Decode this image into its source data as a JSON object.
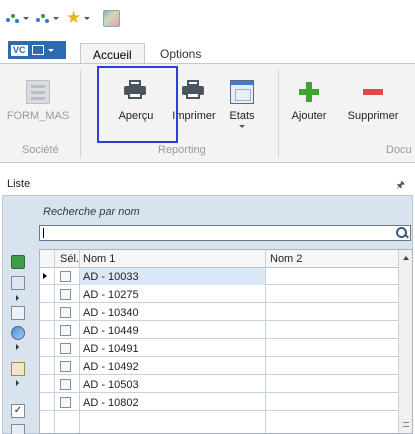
{
  "quick_access": {
    "icons": [
      "app-dots-icon",
      "app-dots-icon",
      "favorites-star-icon",
      "image-icon"
    ]
  },
  "tabs": {
    "file_badge": "VC",
    "items": [
      {
        "label": "Accueil",
        "active": true
      },
      {
        "label": "Options",
        "active": false
      }
    ]
  },
  "ribbon": {
    "buttons": [
      {
        "label": "FORM_MAS",
        "icon": "form-icon",
        "disabled": true
      },
      {
        "label": "Aperçu",
        "icon": "print-preview-icon",
        "disabled": false
      },
      {
        "label": "Imprimer",
        "icon": "printer-icon",
        "disabled": false
      },
      {
        "label": "Etats",
        "icon": "reports-icon",
        "disabled": false
      },
      {
        "label": "Ajouter",
        "icon": "add-icon",
        "disabled": false
      },
      {
        "label": "Supprimer",
        "icon": "delete-icon",
        "disabled": false
      }
    ],
    "groups": [
      "Société",
      "Reporting",
      "Docu"
    ]
  },
  "panel": {
    "title": "Liste",
    "search_label": "Recherche par nom",
    "search_value": "",
    "columns": [
      "Sél.",
      "Nom 1",
      "Nom 2"
    ],
    "rows": [
      {
        "nom1": "AD - 10033",
        "nom2": "",
        "current": true
      },
      {
        "nom1": "AD - 10275",
        "nom2": ""
      },
      {
        "nom1": "AD - 10340",
        "nom2": ""
      },
      {
        "nom1": "AD - 10449",
        "nom2": ""
      },
      {
        "nom1": "AD - 10491",
        "nom2": ""
      },
      {
        "nom1": "AD - 10492",
        "nom2": ""
      },
      {
        "nom1": "AD - 10503",
        "nom2": ""
      },
      {
        "nom1": "AD - 10802",
        "nom2": ""
      }
    ]
  },
  "colors": {
    "highlight_border": "#2f3fd4",
    "file_button": "#2c6bb0",
    "panel_bg": "#d9e3ee",
    "add_green": "#3ea52f",
    "delete_red": "#e0484c"
  }
}
